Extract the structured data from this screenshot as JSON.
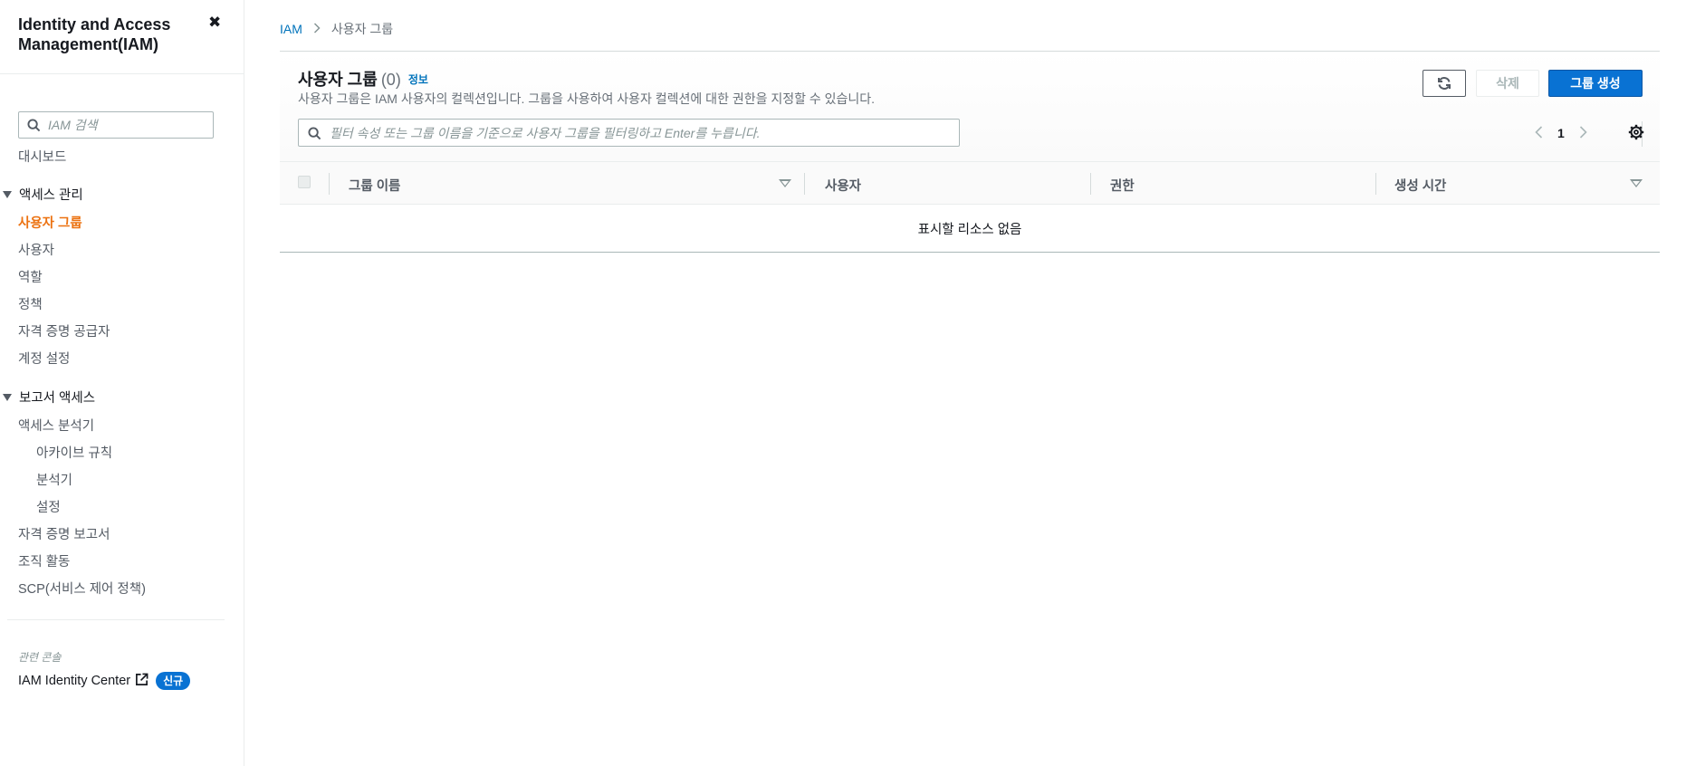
{
  "sidebar": {
    "title": "Identity and Access Management(IAM)",
    "search_placeholder": "IAM 검색",
    "dashboard": "대시보드",
    "access_management": {
      "label": "액세스 관리",
      "items": [
        "사용자 그룹",
        "사용자",
        "역할",
        "정책",
        "자격 증명 공급자",
        "계정 설정"
      ]
    },
    "access_reports": {
      "label": "보고서 액세스",
      "analyzer": "액세스 분석기",
      "analyzer_sub": [
        "아카이브 규칙",
        "분석기",
        "설정"
      ],
      "items": [
        "자격 증명 보고서",
        "조직 활동",
        "SCP(서비스 제어 정책)"
      ]
    },
    "related_consoles_label": "관련 콘솔",
    "identity_center": "IAM Identity Center",
    "new_badge": "신규"
  },
  "breadcrumb": {
    "root": "IAM",
    "current": "사용자 그룹"
  },
  "panel": {
    "title": "사용자 그룹",
    "count": "(0)",
    "info": "정보",
    "description": "사용자 그룹은 IAM 사용자의 컬렉션입니다. 그룹을 사용하여 사용자 컬렉션에 대한 권한을 지정할 수 있습니다.",
    "delete_label": "삭제",
    "create_label": "그룹 생성",
    "filter_placeholder": "필터 속성 또는 그룹 이름을 기준으로 사용자 그룹을 필터링하고 Enter를 누릅니다.",
    "page": "1"
  },
  "table": {
    "columns": [
      "그룹 이름",
      "사용자",
      "권한",
      "생성 시간"
    ],
    "empty_text": "표시할 리소스 없음"
  },
  "colors": {
    "active_nav": "#ec7211",
    "link": "#0073bb",
    "primary_button": "#0972d3"
  }
}
